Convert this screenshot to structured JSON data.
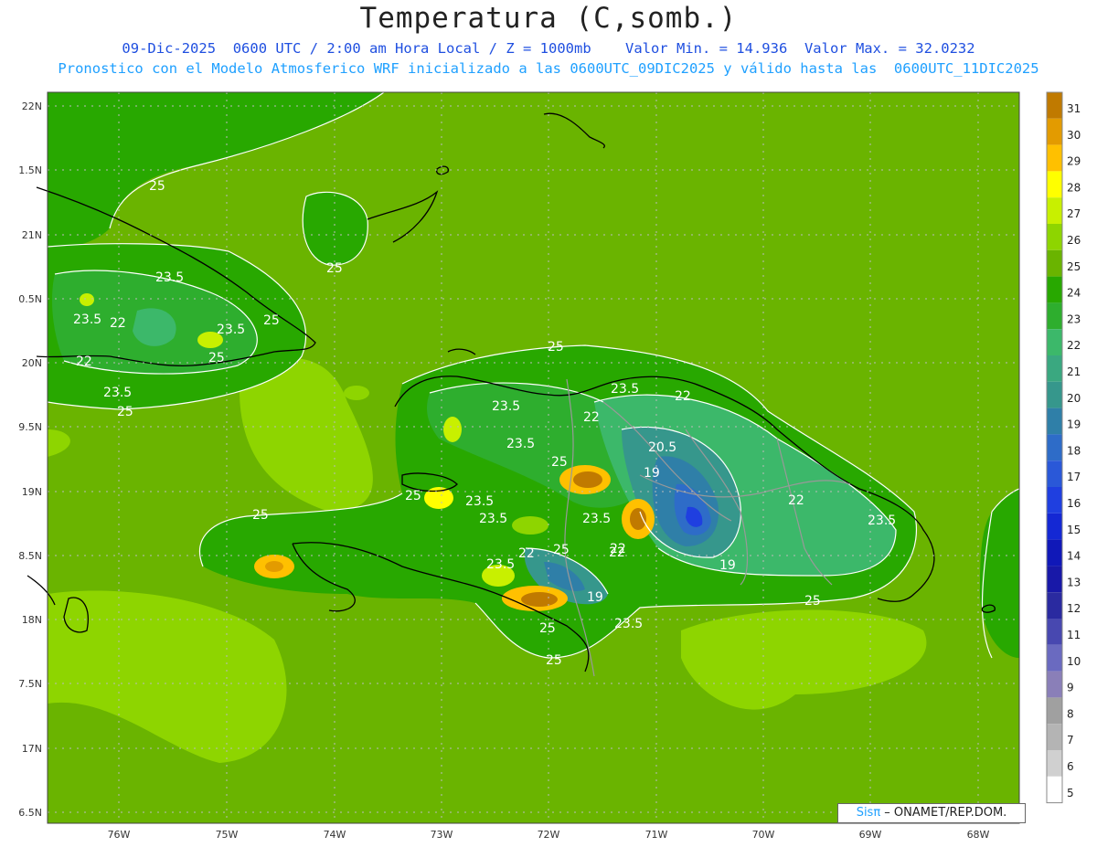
{
  "header": {
    "title": "Temperatura (C,somb.)",
    "subtitle_line1": "09-Dic-2025  0600 UTC / 2:00 am Hora Local / Z = 1000mb    Valor Min. = 14.936  Valor Max. = 32.0232",
    "subtitle_line2": "Pronostico con el Modelo Atmosferico WRF inicializado a las 0600UTC_09DIC2025 y válido hasta las  0600UTC_11DIC2025"
  },
  "axes": {
    "lat_labels": [
      "22N",
      "1.5N",
      "21N",
      "0.5N",
      "20N",
      "9.5N",
      "19N",
      "8.5N",
      "18N",
      "7.5N",
      "17N",
      "6.5N"
    ],
    "lon_labels": [
      "76W",
      "75W",
      "74W",
      "73W",
      "72W",
      "71W",
      "70W",
      "69W",
      "68W"
    ]
  },
  "colorbar": {
    "labels": [
      "31",
      "30",
      "29",
      "28",
      "27",
      "26",
      "25",
      "24",
      "23",
      "22",
      "21",
      "20",
      "19",
      "18",
      "17",
      "16",
      "15",
      "14",
      "13",
      "12",
      "11",
      "10",
      "9",
      "8",
      "7",
      "6",
      "5"
    ],
    "colors": [
      "#c07a00",
      "#e39b00",
      "#ffc000",
      "#ffff00",
      "#c8f000",
      "#8ed500",
      "#6ab400",
      "#28a800",
      "#2eae2e",
      "#3cb86a",
      "#3aa880",
      "#36978c",
      "#2f7fa8",
      "#2e6cc8",
      "#2a58d8",
      "#1f3fe0",
      "#1428d4",
      "#1018b8",
      "#1818a8",
      "#2a2aa0",
      "#4848b0",
      "#6a6ac0",
      "#8a7fb8",
      "#a0a0a0",
      "#b4b4b4",
      "#d0d0d0",
      "#ffffff"
    ]
  },
  "contour_labels": [
    "25",
    "25",
    "25",
    "23.5",
    "22",
    "23.5",
    "23.5",
    "25",
    "22",
    "23.5",
    "25",
    "25",
    "23.5",
    "22",
    "23.5",
    "22",
    "23.5",
    "25",
    "20.5",
    "19",
    "25",
    "22",
    "23.5",
    "23.5",
    "23.5",
    "22",
    "25",
    "22",
    "19",
    "19",
    "23.5",
    "25",
    "25",
    "25",
    "25",
    "22",
    "23.5",
    "19"
  ],
  "credit": {
    "sis": "Sisπ",
    "rest": " – ONAMET/REP.DOM."
  }
}
